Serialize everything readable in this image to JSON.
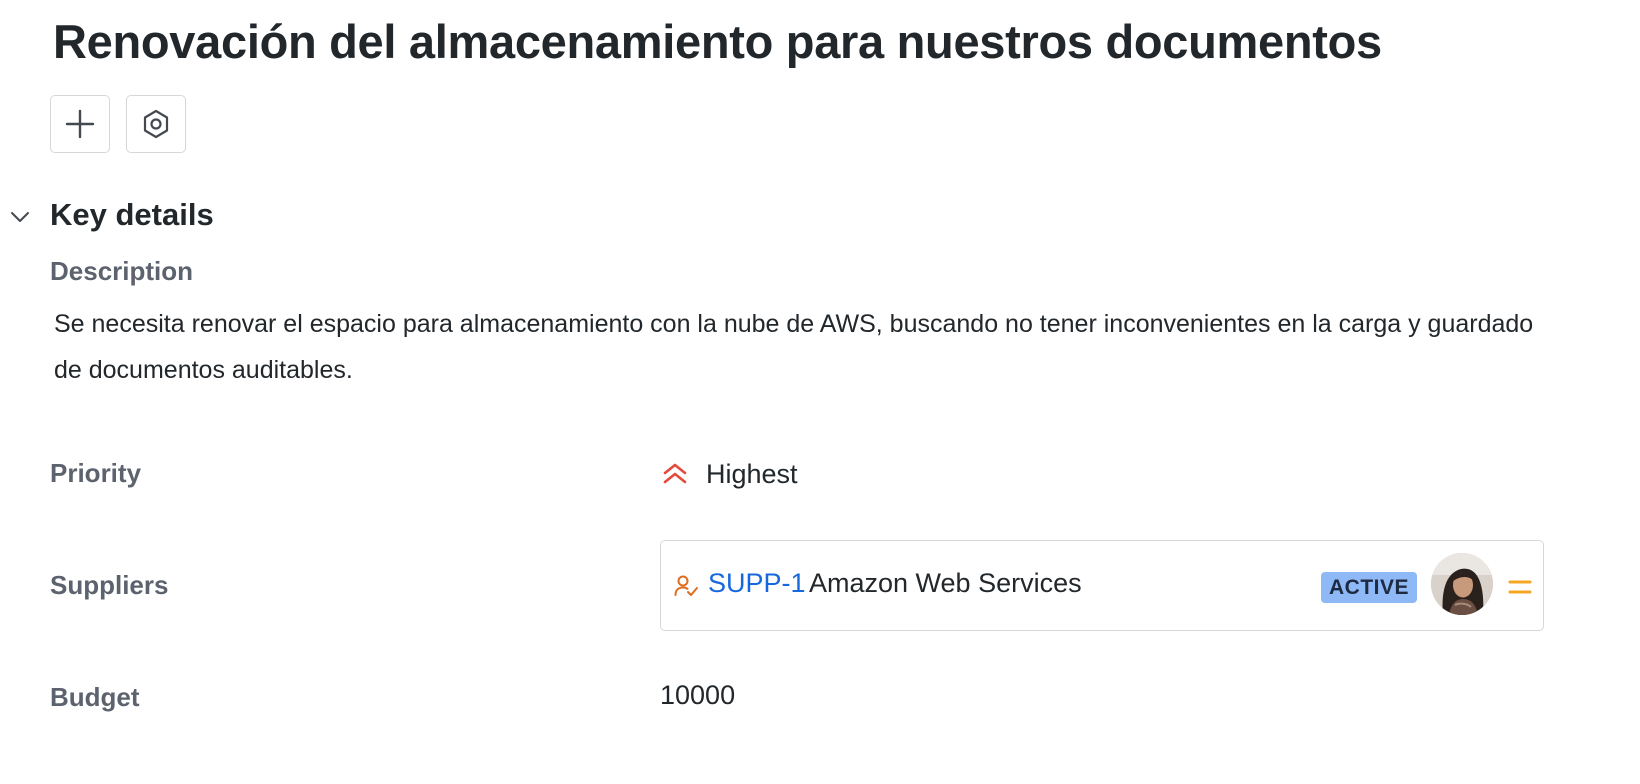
{
  "header": {
    "title": "Renovación del almacenamiento para nuestros documentos"
  },
  "toolbar": {
    "add_icon": "plus-icon",
    "settings_icon": "hexagon-gear-icon"
  },
  "section": {
    "title": "Key details",
    "toggle_icon": "chevron-down-icon"
  },
  "fields": {
    "description_label": "Description",
    "description_text": "Se necesita renovar el espacio para almacenamiento con la nube de AWS, buscando no tener inconvenientes en la carga y guardado de documentos auditables.",
    "priority_label": "Priority",
    "priority_value": "Highest",
    "priority_icon": "double-chevron-up-icon",
    "priority_color": "#e5493a",
    "suppliers_label": "Suppliers",
    "supplier": {
      "key": "SUPP-1",
      "name": "Amazon Web Services",
      "status": "ACTIVE",
      "icon": "user-check-icon",
      "icon_color": "#e06c1f",
      "status_color": "#8fb8f6",
      "menu_icon": "equals-icon",
      "menu_color": "#f5a623"
    },
    "budget_label": "Budget",
    "budget_value": "10000"
  }
}
